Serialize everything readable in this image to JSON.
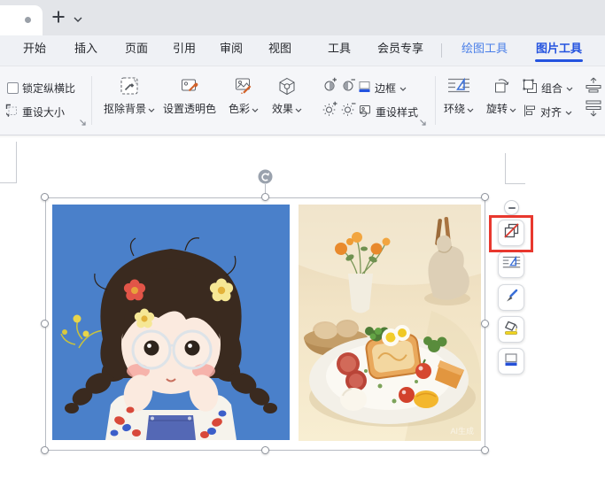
{
  "titlebar": {
    "unsaved_indicator": true
  },
  "menu": {
    "tabs": [
      {
        "label": "开始"
      },
      {
        "label": "插入"
      },
      {
        "label": "页面"
      },
      {
        "label": "引用"
      },
      {
        "label": "审阅"
      },
      {
        "label": "视图"
      },
      {
        "label": "工具"
      },
      {
        "label": "会员专享"
      },
      {
        "label": "绘图工具",
        "highlight": "context-blue"
      },
      {
        "label": "图片工具",
        "highlight": "active-blue-underline"
      }
    ]
  },
  "ribbon": {
    "lock_aspect": {
      "label": "锁定纵横比",
      "checked": false
    },
    "reset_size": {
      "label": "重设大小"
    },
    "remove_background": {
      "label": "抠除背景",
      "has_dropdown": true
    },
    "set_transparent_color": {
      "label": "设置透明色"
    },
    "color": {
      "label": "色彩",
      "has_dropdown": true
    },
    "effects": {
      "label": "效果",
      "has_dropdown": true
    },
    "border": {
      "label": "边框",
      "has_dropdown": true
    },
    "reset_style": {
      "label": "重设样式"
    },
    "wrap": {
      "label": "环绕",
      "has_dropdown": true
    },
    "rotate": {
      "label": "旋转",
      "has_dropdown": true
    },
    "group": {
      "label": "组合",
      "has_dropdown": true
    },
    "align": {
      "label": "对齐",
      "has_dropdown": true
    }
  },
  "canvas": {
    "selected_images": [
      {
        "name": "girl-illustration",
        "description": "cartoon girl with braids, glasses and flowers on blue background"
      },
      {
        "name": "breakfast-photo",
        "description": "plate of breakfast food with flowers, jug and egg basket on beige table"
      }
    ],
    "watermark": "AI生成"
  },
  "float_toolbar": {
    "buttons": [
      {
        "name": "group-pictures",
        "highlighted": true
      },
      {
        "name": "wrap-layout"
      },
      {
        "name": "style-brush"
      },
      {
        "name": "fill-color"
      },
      {
        "name": "border-style"
      }
    ],
    "icons": {
      "collapse": "minus",
      "group_pictures": "overlap-squares-red-slash",
      "wrap_layout": "triangle-with-lines",
      "style_brush": "blue-brush",
      "fill_color": "yellow-paint-bucket",
      "border_style": "square-blue-bottom"
    }
  },
  "icons": {
    "new_tab": "plus",
    "tab_list": "chevron-down",
    "dropdown": "chevron-down",
    "dialog_launcher": "arrow-down-right",
    "rotation_handle": "rotate-arrow"
  },
  "colors": {
    "active_tab_blue": "#2453df",
    "context_tab_blue": "#4a7fe8",
    "annotation_red": "#e8382e",
    "accent_orange": "#d2622a",
    "icon_blue": "#3a6fd8"
  }
}
